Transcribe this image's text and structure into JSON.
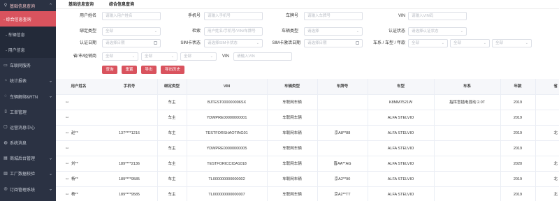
{
  "sidebar": {
    "top": "基础信息查询",
    "active": "- 综合信息查询",
    "subs": [
      "- 车辆信息",
      "- 用户信息"
    ],
    "items": [
      "车联网服务",
      "统计报表",
      "车辆解绑&RTN",
      "工单管理",
      "运营消息中心",
      "系统消息",
      "商城后台管理",
      "工厂数据校验",
      "订阅管理系统"
    ]
  },
  "tabs": [
    "基础信息查询",
    "综合信息查询"
  ],
  "form": {
    "row1": {
      "user_label": "用户姓名",
      "user_ph": "请输入用户姓名",
      "phone_label": "手机号",
      "phone_ph": "请输入手机号",
      "plate_label": "车牌号",
      "plate_ph": "请输入车牌号",
      "vin_label": "VIN",
      "vin_ph": "请输入VIN码"
    },
    "row2": {
      "bind_label": "绑定类型",
      "bind_val": "全部",
      "search_label": "检索",
      "search_ph": "用户姓名/手机号/VIN/车牌号",
      "vtype_label": "车辆类型",
      "vtype_ph": "请选择",
      "auth_label": "认证状态",
      "auth_ph": "请选择认证状态"
    },
    "row3": {
      "authdate_label": "认证日期",
      "authdate_ph": "请选择日期",
      "sim_label": "SIM卡状态",
      "sim_ph": "请选择SIM卡状态",
      "simdate_label": "SIM卡激活日期",
      "simdate_ph": "请选择日期",
      "series_label": "车系 / 车型 / 年款",
      "series_vals": [
        "全部",
        "全部",
        "全部"
      ]
    },
    "row4": {
      "region_label": "省/市/经销商",
      "region_vals": [
        "全部",
        "全部",
        "全部"
      ],
      "vin2_label": "VIN",
      "vin2_ph": "请输入VIN"
    },
    "buttons": [
      "查询",
      "重置",
      "导出",
      "导出历史"
    ]
  },
  "table": {
    "headers": [
      "用户姓名",
      "手机号",
      "绑定类型",
      "VIN",
      "车辆类型",
      "车牌号",
      "车型",
      "车系",
      "年款",
      "省"
    ],
    "rows": [
      [
        "",
        "",
        "车主",
        "BJTEST000000006SX",
        "车联网车辆",
        "",
        "K8MM7521W",
        "指挥官插电混动 2.0T",
        "2019",
        ""
      ],
      [
        "",
        "",
        "车主",
        "YDWPRE00000000001",
        "车联网车辆",
        "",
        "ALFA STELVIO",
        "",
        "2019",
        ""
      ],
      [
        "赵**",
        "137****1216",
        "车主",
        "TESTFORSHAOTING01",
        "车联网车辆",
        "京A8**88",
        "ALFA STELVIO",
        "",
        "2019",
        "北"
      ],
      [
        "",
        "",
        "车主",
        "YDWPRE00000000005",
        "车联网车辆",
        "",
        "ALFA STELVIO",
        "",
        "2019",
        ""
      ],
      [
        "刘**",
        "189****2136",
        "车主",
        "TESTFORICCIDA1018",
        "车联网车辆",
        "晋AA**AG",
        "ALFA STELVIO",
        "",
        "2020",
        "北"
      ],
      [
        "杨**",
        "189****9585",
        "车主",
        "TL000000000000002",
        "车联网车辆",
        "京A2**90",
        "ALFA STELVIO",
        "",
        "2019",
        "北"
      ],
      [
        "杨**",
        "189****9585",
        "车主",
        "TL000000000000007",
        "车联网车辆",
        "京A2**TT",
        "ALFA STELVIO",
        "",
        "2019",
        "北"
      ]
    ]
  }
}
